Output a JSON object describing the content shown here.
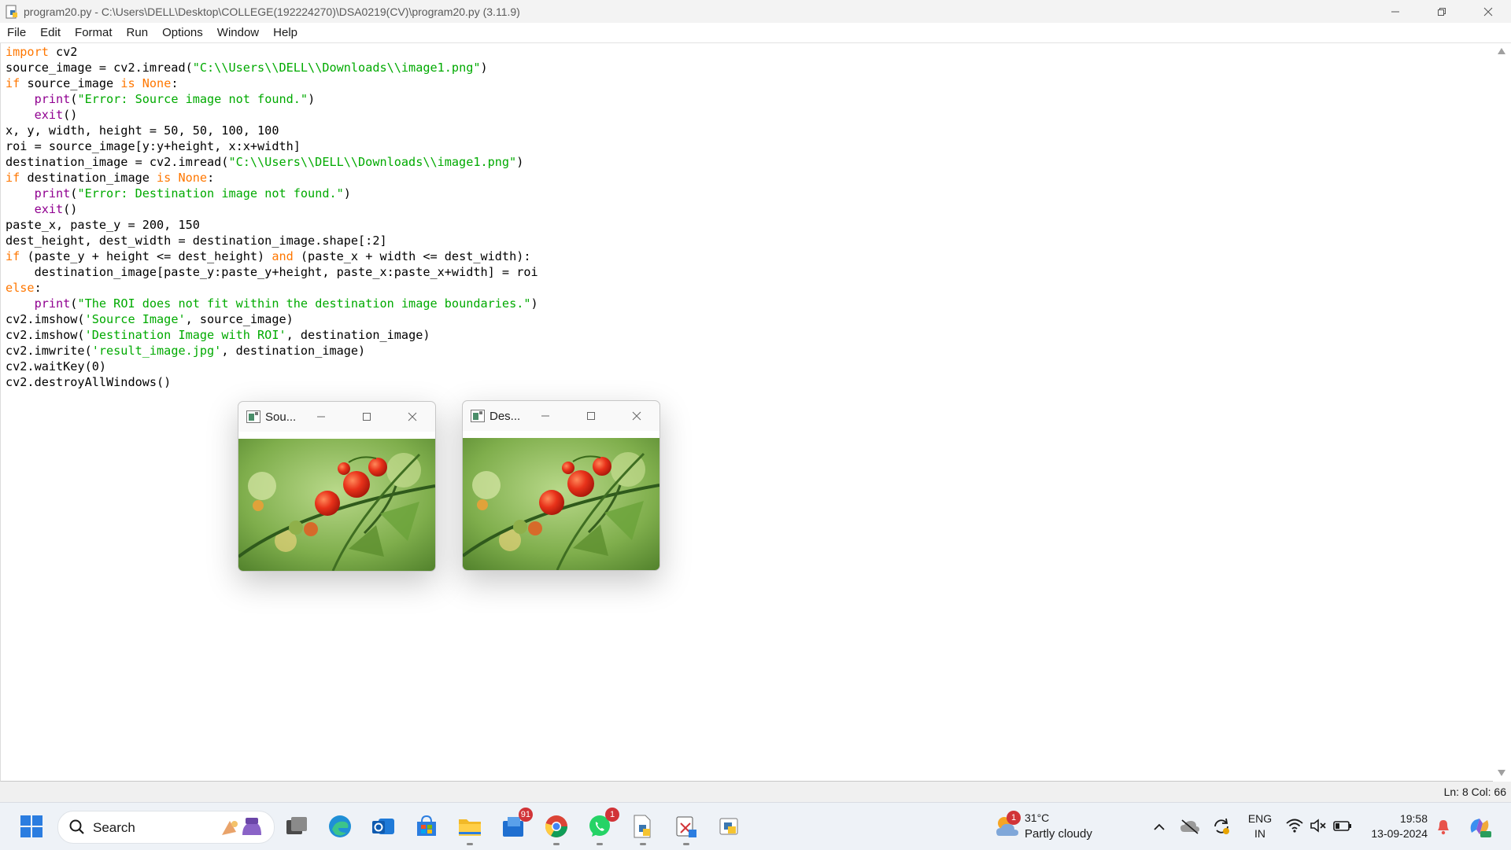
{
  "window": {
    "title": "program20.py - C:\\Users\\DELL\\Desktop\\COLLEGE(192224270)\\DSA0219(CV)\\program20.py (3.11.9)"
  },
  "menu": [
    "File",
    "Edit",
    "Format",
    "Run",
    "Options",
    "Window",
    "Help"
  ],
  "editor": {
    "lines": [
      [
        {
          "t": "import",
          "c": "kw"
        },
        {
          "t": " cv2"
        }
      ],
      [
        {
          "t": "source_image = cv2.imread("
        },
        {
          "t": "\"C:\\\\Users\\\\DELL\\\\Downloads\\\\image1.png\"",
          "c": "str"
        },
        {
          "t": ")"
        }
      ],
      [
        {
          "t": "if",
          "c": "kw"
        },
        {
          "t": " source_image "
        },
        {
          "t": "is",
          "c": "kw"
        },
        {
          "t": " "
        },
        {
          "t": "None",
          "c": "kw"
        },
        {
          "t": ":"
        }
      ],
      [
        {
          "t": "    "
        },
        {
          "t": "print",
          "c": "bi"
        },
        {
          "t": "("
        },
        {
          "t": "\"Error: Source image not found.\"",
          "c": "str"
        },
        {
          "t": ")"
        }
      ],
      [
        {
          "t": "    "
        },
        {
          "t": "exit",
          "c": "bi"
        },
        {
          "t": "()"
        }
      ],
      [
        {
          "t": "x, y, width, height = 50, 50, 100, 100"
        }
      ],
      [
        {
          "t": "roi = source_image[y:y+height, x:x+width]"
        }
      ],
      [
        {
          "t": "destination_image = cv2.imread("
        },
        {
          "t": "\"C:\\\\Users\\\\DELL\\\\Downloads\\\\image1.png\"",
          "c": "str"
        },
        {
          "t": ")"
        }
      ],
      [
        {
          "t": "if",
          "c": "kw"
        },
        {
          "t": " destination_image "
        },
        {
          "t": "is",
          "c": "kw"
        },
        {
          "t": " "
        },
        {
          "t": "None",
          "c": "kw"
        },
        {
          "t": ":"
        }
      ],
      [
        {
          "t": "    "
        },
        {
          "t": "print",
          "c": "bi"
        },
        {
          "t": "("
        },
        {
          "t": "\"Error: Destination image not found.\"",
          "c": "str"
        },
        {
          "t": ")"
        }
      ],
      [
        {
          "t": "    "
        },
        {
          "t": "exit",
          "c": "bi"
        },
        {
          "t": "()"
        }
      ],
      [
        {
          "t": "paste_x, paste_y = 200, 150"
        }
      ],
      [
        {
          "t": "dest_height, dest_width = destination_image.shape[:2]"
        }
      ],
      [
        {
          "t": "if",
          "c": "kw"
        },
        {
          "t": " (paste_y + height <= dest_height) "
        },
        {
          "t": "and",
          "c": "kw"
        },
        {
          "t": " (paste_x + width <= dest_width):"
        }
      ],
      [
        {
          "t": "    destination_image[paste_y:paste_y+height, paste_x:paste_x+width] = roi"
        }
      ],
      [
        {
          "t": "else",
          "c": "kw"
        },
        {
          "t": ":"
        }
      ],
      [
        {
          "t": "    "
        },
        {
          "t": "print",
          "c": "bi"
        },
        {
          "t": "("
        },
        {
          "t": "\"The ROI does not fit within the destination image boundaries.\"",
          "c": "str"
        },
        {
          "t": ")"
        }
      ],
      [
        {
          "t": "cv2.imshow("
        },
        {
          "t": "'Source Image'",
          "c": "str"
        },
        {
          "t": ", source_image)"
        }
      ],
      [
        {
          "t": "cv2.imshow("
        },
        {
          "t": "'Destination Image with ROI'",
          "c": "str"
        },
        {
          "t": ", destination_image)"
        }
      ],
      [
        {
          "t": "cv2.imwrite("
        },
        {
          "t": "'result_image.jpg'",
          "c": "str"
        },
        {
          "t": ", destination_image)"
        }
      ],
      [
        {
          "t": "cv2.waitKey(0)"
        }
      ],
      [
        {
          "t": "cv2.destroyAllWindows()"
        }
      ]
    ]
  },
  "status": {
    "position": "Ln: 8   Col: 66"
  },
  "popups": {
    "source": {
      "title": "Sou..."
    },
    "destination": {
      "title": "Des..."
    }
  },
  "taskbar": {
    "search_label": "Search",
    "mail_badge": "91",
    "whatsapp_badge": "1",
    "weather": {
      "temp": "31°C",
      "desc": "Partly cloudy",
      "badge": "1"
    },
    "lang_top": "ENG",
    "lang_bottom": "IN",
    "time": "19:58",
    "date": "13-09-2024"
  },
  "colors": {
    "keyword": "#ff7700",
    "builtin": "#900090",
    "string": "#00aa00",
    "taskbar": "#eef2f7",
    "badge": "#d13438"
  }
}
